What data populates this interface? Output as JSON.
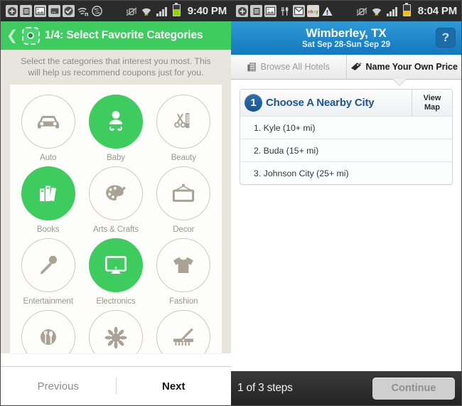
{
  "left_phone": {
    "status_bar": {
      "time": "9:40 PM",
      "left_icons": [
        "add-icon",
        "calendar-icon",
        "gallery-icon",
        "message-icon",
        "checkmark-icon",
        "wifi-transfer-icon",
        "s-circle-icon"
      ],
      "right_icons": [
        "vibrate-mute-icon",
        "wifi-icon",
        "signal-bars-icon",
        "battery-icon"
      ]
    },
    "header": {
      "back_icon": "back-chevron-icon",
      "app_icon": "coupon-app-icon",
      "title": "1/4: Select Favorite Categories"
    },
    "subtitle": "Select the categories that interest you most. This will help us recommend coupons just for you.",
    "categories": [
      {
        "label": "Auto",
        "icon": "car-icon",
        "selected": false
      },
      {
        "label": "Baby",
        "icon": "baby-icon",
        "selected": true
      },
      {
        "label": "Beauty",
        "icon": "comb-scissors-icon",
        "selected": false
      },
      {
        "label": "Books",
        "icon": "books-icon",
        "selected": true
      },
      {
        "label": "Arts & Crafts",
        "icon": "palette-brush-icon",
        "selected": false
      },
      {
        "label": "Decor",
        "icon": "picture-frame-icon",
        "selected": false
      },
      {
        "label": "Entertainment",
        "icon": "microphone-icon",
        "selected": false
      },
      {
        "label": "Electronics",
        "icon": "monitor-icon",
        "selected": true
      },
      {
        "label": "Fashion",
        "icon": "tshirt-icon",
        "selected": false
      },
      {
        "label": "",
        "icon": "dining-icon",
        "selected": false
      },
      {
        "label": "",
        "icon": "flower-sun-icon",
        "selected": false
      },
      {
        "label": "",
        "icon": "garden-rake-icon",
        "selected": false
      }
    ],
    "footer": {
      "previous_label": "Previous",
      "next_label": "Next"
    },
    "colors": {
      "accent_green": "#3ECC5F",
      "icon_gray": "#A9A395",
      "page_bg": "#E8E5DF"
    }
  },
  "right_phone": {
    "status_bar": {
      "time": "8:04 PM",
      "left_icons": [
        "add-icon",
        "calendar-icon",
        "gallery-icon",
        "restaurant-icon",
        "mail-icon",
        "ebay-icon",
        "warning-icon"
      ],
      "right_icons": [
        "vibrate-mute-icon",
        "wifi-icon",
        "signal-bars-icon",
        "battery-icon"
      ]
    },
    "header": {
      "title": "Wimberley, TX",
      "subtitle": "Sat Sep 28-Sun Sep 29",
      "help_label": "?",
      "help_icon": "help-icon"
    },
    "tabs": [
      {
        "label": "Browse All Hotels",
        "icon": "hotel-icon",
        "active": false
      },
      {
        "label": "Name Your Own Price",
        "icon": "price-tag-icon",
        "active": true
      }
    ],
    "card": {
      "step_number": "1",
      "heading": "Choose A Nearby City",
      "view_map_line1": "View",
      "view_map_line2": "Map",
      "cities": [
        "1. Kyle (10+ mi)",
        "2. Buda (15+ mi)",
        "3. Johnson City (25+ mi)"
      ]
    },
    "footer": {
      "steps_label": "1 of 3 steps",
      "continue_label": "Continue"
    },
    "colors": {
      "header_blue": "#1378bd",
      "badge_blue": "#1a5590",
      "heading_blue": "#1c5695"
    }
  }
}
